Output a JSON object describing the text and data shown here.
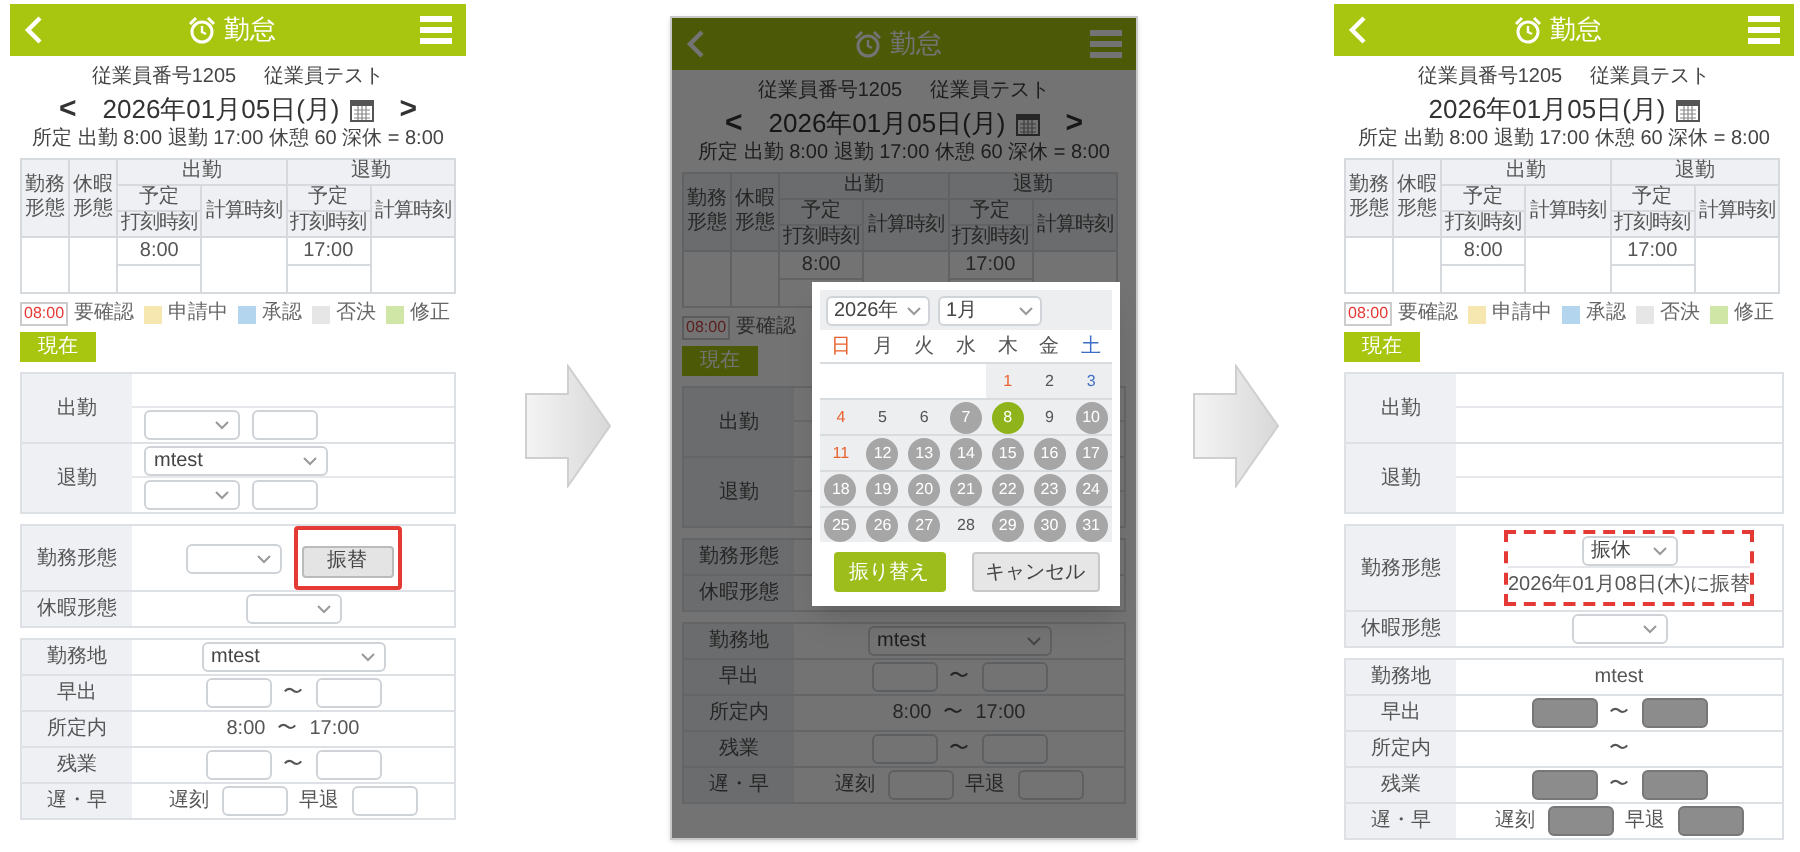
{
  "screens": [
    {
      "header": {
        "title": "勤怠"
      },
      "employee_no": "従業員番号1205",
      "employee_name": "従業員テスト",
      "date": "2026年01月05日(月)",
      "prev_day": "<",
      "next_day": ">",
      "schedule": "所定 出勤 8:00 退勤 17:00 休憩 60 深休 = 8:00",
      "table": {
        "work_type": "勤務形態",
        "leave_type": "休暇形態",
        "groups": [
          {
            "title": "出勤",
            "planned": "予定",
            "stamped": "打刻時刻",
            "calculated": "計算時刻",
            "planned_time": "8:00"
          },
          {
            "title": "退勤",
            "planned": "予定",
            "stamped": "打刻時刻",
            "calculated": "計算時刻",
            "planned_time": "17:00"
          }
        ]
      },
      "legend": [
        {
          "kind": "sample",
          "sample": "08:00",
          "label": "要確認",
          "color": "#e53935"
        },
        {
          "kind": "swatch",
          "label": "申請中",
          "color": "#f6e7b0"
        },
        {
          "kind": "swatch",
          "label": "承認",
          "color": "#b3d6ee"
        },
        {
          "kind": "swatch",
          "label": "否決",
          "color": "#e6e6e6"
        },
        {
          "kind": "swatch",
          "label": "修正",
          "color": "#cfe6a6"
        }
      ],
      "now_button": "現在",
      "sections": [
        {
          "kind": "punch",
          "rows": [
            {
              "label": "出勤",
              "lines": [
                {
                  "kind": "blank"
                },
                {
                  "kind": "fields",
                  "items": [
                    {
                      "kind": "select"
                    },
                    {
                      "kind": "input",
                      "disabled": false
                    }
                  ]
                }
              ]
            },
            {
              "label": "退勤",
              "lines": [
                {
                  "kind": "fields",
                  "items": [
                    {
                      "kind": "select",
                      "value": "mtest",
                      "wide": true
                    }
                  ]
                },
                {
                  "kind": "fields",
                  "items": [
                    {
                      "kind": "select"
                    },
                    {
                      "kind": "input",
                      "disabled": false
                    }
                  ]
                }
              ]
            }
          ]
        },
        {
          "kind": "detail",
          "rows": [
            {
              "label": "勤務形態",
              "lines": [
                {
                  "kind": "fields",
                  "items": [
                    {
                      "kind": "select"
                    },
                    {
                      "kind": "button",
                      "label": "振替",
                      "outlined": true
                    }
                  ]
                }
              ]
            },
            {
              "label": "休暇形態",
              "lines": [
                {
                  "kind": "fields",
                  "items": [
                    {
                      "kind": "select"
                    }
                  ]
                }
              ]
            }
          ]
        },
        {
          "kind": "detail",
          "rows": [
            {
              "label": "勤務地",
              "lines": [
                {
                  "kind": "fields",
                  "items": [
                    {
                      "kind": "select",
                      "value": "mtest",
                      "wide": true
                    }
                  ]
                }
              ]
            },
            {
              "label": "早出",
              "lines": [
                {
                  "kind": "fields",
                  "items": [
                    {
                      "kind": "input",
                      "disabled": false
                    },
                    {
                      "kind": "text",
                      "text": "〜"
                    },
                    {
                      "kind": "input",
                      "disabled": false
                    }
                  ]
                }
              ]
            },
            {
              "label": "所定内",
              "lines": [
                {
                  "kind": "fields",
                  "items": [
                    {
                      "kind": "text",
                      "text": "8:00"
                    },
                    {
                      "kind": "text",
                      "text": "〜"
                    },
                    {
                      "kind": "text",
                      "text": "17:00"
                    }
                  ]
                }
              ]
            },
            {
              "label": "残業",
              "lines": [
                {
                  "kind": "fields",
                  "items": [
                    {
                      "kind": "input",
                      "disabled": false
                    },
                    {
                      "kind": "text",
                      "text": "〜"
                    },
                    {
                      "kind": "input",
                      "disabled": false
                    }
                  ]
                }
              ]
            },
            {
              "label": "遅・早",
              "lines": [
                {
                  "kind": "fields",
                  "items": [
                    {
                      "kind": "text",
                      "text": "遅刻"
                    },
                    {
                      "kind": "input",
                      "disabled": false
                    },
                    {
                      "kind": "text",
                      "text": "早退"
                    },
                    {
                      "kind": "input",
                      "disabled": false
                    }
                  ]
                }
              ]
            }
          ]
        }
      ]
    },
    {
      "header": {
        "title": "勤怠"
      },
      "employee_no": "従業員番号1205",
      "employee_name": "従業員テスト",
      "date": "2026年01月05日(月)",
      "prev_day": "<",
      "next_day": ">",
      "schedule": "所定 出勤 8:00 退勤 17:00 休憩 60 深休 = 8:00",
      "table": {
        "work_type": "勤務形態",
        "leave_type": "休暇形態",
        "groups": [
          {
            "title": "出勤",
            "planned": "予定",
            "stamped": "打刻時刻",
            "calculated": "計算時刻",
            "planned_time": "8:00"
          },
          {
            "title": "退勤",
            "planned": "予定",
            "stamped": "打刻時刻",
            "calculated": "計算時刻",
            "planned_time": "17:00"
          }
        ]
      },
      "legend": [
        {
          "kind": "sample",
          "sample": "08:00",
          "label": "要確認"
        }
      ],
      "now_button": "現在",
      "sections": [
        {
          "kind": "punch",
          "rows": [
            {
              "label": "出勤",
              "lines": [
                {
                  "kind": "blank"
                },
                {
                  "kind": "blank"
                }
              ]
            },
            {
              "label": "退勤",
              "lines": [
                {
                  "kind": "blank"
                },
                {
                  "kind": "blank"
                }
              ]
            }
          ]
        },
        {
          "kind": "detail",
          "rows": [
            {
              "label": "勤務形態",
              "lines": [
                {
                  "kind": "blank"
                }
              ]
            },
            {
              "label": "休暇形態",
              "lines": [
                {
                  "kind": "blank"
                }
              ]
            }
          ]
        },
        {
          "kind": "detail",
          "rows": [
            {
              "label": "勤務地",
              "lines": [
                {
                  "kind": "fields",
                  "items": [
                    {
                      "kind": "select",
                      "value": "mtest",
                      "wide": true
                    }
                  ]
                }
              ]
            },
            {
              "label": "早出",
              "lines": [
                {
                  "kind": "fields",
                  "items": [
                    {
                      "kind": "input",
                      "disabled": false
                    },
                    {
                      "kind": "text",
                      "text": "〜"
                    },
                    {
                      "kind": "input",
                      "disabled": false
                    }
                  ]
                }
              ]
            },
            {
              "label": "所定内",
              "lines": [
                {
                  "kind": "fields",
                  "items": [
                    {
                      "kind": "text",
                      "text": "8:00"
                    },
                    {
                      "kind": "text",
                      "text": "〜"
                    },
                    {
                      "kind": "text",
                      "text": "17:00"
                    }
                  ]
                }
              ]
            },
            {
              "label": "残業",
              "lines": [
                {
                  "kind": "fields",
                  "items": [
                    {
                      "kind": "input",
                      "disabled": false
                    },
                    {
                      "kind": "text",
                      "text": "〜"
                    },
                    {
                      "kind": "input",
                      "disabled": false
                    }
                  ]
                }
              ]
            },
            {
              "label": "遅・早",
              "lines": [
                {
                  "kind": "fields",
                  "items": [
                    {
                      "kind": "text",
                      "text": "遅刻"
                    },
                    {
                      "kind": "input",
                      "disabled": false
                    },
                    {
                      "kind": "text",
                      "text": "早退"
                    },
                    {
                      "kind": "input",
                      "disabled": false
                    }
                  ]
                }
              ]
            }
          ]
        }
      ],
      "dialog": {
        "year": "2026年",
        "month": "1月",
        "weekdays": [
          {
            "label": "日",
            "kind": "sunday"
          },
          {
            "label": "月",
            "kind": "weekday"
          },
          {
            "label": "火",
            "kind": "weekday"
          },
          {
            "label": "水",
            "kind": "weekday"
          },
          {
            "label": "木",
            "kind": "weekday"
          },
          {
            "label": "金",
            "kind": "weekday"
          },
          {
            "label": "土",
            "kind": "saturday"
          }
        ],
        "weeks": [
          [
            {
              "kind": "blank"
            },
            {
              "kind": "blank"
            },
            {
              "kind": "blank"
            },
            {
              "kind": "blank"
            },
            {
              "day": "1",
              "kind": "holiday",
              "disabled": false,
              "selected": false
            },
            {
              "day": "2",
              "kind": "weekday",
              "disabled": false,
              "selected": false
            },
            {
              "day": "3",
              "kind": "saturday",
              "disabled": false,
              "selected": false
            }
          ],
          [
            {
              "day": "4",
              "kind": "sunday",
              "disabled": false,
              "selected": false
            },
            {
              "day": "5",
              "kind": "weekday",
              "disabled": false,
              "selected": false
            },
            {
              "day": "6",
              "kind": "weekday",
              "disabled": false,
              "selected": false
            },
            {
              "day": "7",
              "disabled": true,
              "selected": false
            },
            {
              "day": "8",
              "disabled": false,
              "selected": true
            },
            {
              "day": "9",
              "kind": "weekday",
              "disabled": false,
              "selected": false
            },
            {
              "day": "10",
              "disabled": true,
              "selected": false
            }
          ],
          [
            {
              "day": "11",
              "kind": "sunday",
              "disabled": false,
              "selected": false
            },
            {
              "day": "12",
              "disabled": true,
              "selected": false
            },
            {
              "day": "13",
              "disabled": true,
              "selected": false
            },
            {
              "day": "14",
              "disabled": true,
              "selected": false
            },
            {
              "day": "15",
              "disabled": true,
              "selected": false
            },
            {
              "day": "16",
              "disabled": true,
              "selected": false
            },
            {
              "day": "17",
              "disabled": true,
              "selected": false
            }
          ],
          [
            {
              "day": "18",
              "disabled": true,
              "selected": false
            },
            {
              "day": "19",
              "disabled": true,
              "selected": false
            },
            {
              "day": "20",
              "disabled": true,
              "selected": false
            },
            {
              "day": "21",
              "disabled": true,
              "selected": false
            },
            {
              "day": "22",
              "disabled": true,
              "selected": false
            },
            {
              "day": "23",
              "disabled": true,
              "selected": false
            },
            {
              "day": "24",
              "disabled": true,
              "selected": false
            }
          ],
          [
            {
              "day": "25",
              "disabled": true,
              "selected": false
            },
            {
              "day": "26",
              "disabled": true,
              "selected": false
            },
            {
              "day": "27",
              "disabled": true,
              "selected": false
            },
            {
              "day": "28",
              "kind": "weekday",
              "disabled": false,
              "selected": false
            },
            {
              "day": "29",
              "disabled": true,
              "selected": false
            },
            {
              "day": "30",
              "disabled": true,
              "selected": false
            },
            {
              "day": "31",
              "disabled": true,
              "selected": false
            }
          ]
        ],
        "confirm": "振り替え",
        "cancel": "キャンセル"
      }
    },
    {
      "header": {
        "title": "勤怠"
      },
      "employee_no": "従業員番号1205",
      "employee_name": "従業員テスト",
      "date": "2026年01月05日(月)",
      "schedule": "所定 出勤 8:00 退勤 17:00 休憩 60 深休 = 8:00",
      "table": {
        "work_type": "勤務形態",
        "leave_type": "休暇形態",
        "groups": [
          {
            "title": "出勤",
            "planned": "予定",
            "stamped": "打刻時刻",
            "calculated": "計算時刻",
            "planned_time": "8:00"
          },
          {
            "title": "退勤",
            "planned": "予定",
            "stamped": "打刻時刻",
            "calculated": "計算時刻",
            "planned_time": "17:00"
          }
        ]
      },
      "legend": [
        {
          "kind": "sample",
          "sample": "08:00",
          "label": "要確認",
          "color": "#e53935"
        },
        {
          "kind": "swatch",
          "label": "申請中",
          "color": "#f6e7b0"
        },
        {
          "kind": "swatch",
          "label": "承認",
          "color": "#b3d6ee"
        },
        {
          "kind": "swatch",
          "label": "否決",
          "color": "#e6e6e6"
        },
        {
          "kind": "swatch",
          "label": "修正",
          "color": "#cfe6a6"
        }
      ],
      "now_button": "現在",
      "sections": [
        {
          "kind": "punch",
          "rows": [
            {
              "label": "出勤",
              "lines": [
                {
                  "kind": "blank"
                },
                {
                  "kind": "blank"
                }
              ]
            },
            {
              "label": "退勤",
              "lines": [
                {
                  "kind": "blank"
                },
                {
                  "kind": "blank"
                }
              ]
            }
          ]
        },
        {
          "kind": "detail",
          "rows": [
            {
              "label": "勤務形態",
              "callout": true,
              "lines": [
                {
                  "kind": "fields",
                  "items": [
                    {
                      "kind": "select",
                      "value": "振休"
                    }
                  ]
                },
                {
                  "kind": "fields",
                  "items": [
                    {
                      "kind": "text",
                      "text": "2026年01月08日(木)に振替"
                    }
                  ]
                }
              ]
            },
            {
              "label": "休暇形態",
              "lines": [
                {
                  "kind": "fields",
                  "items": [
                    {
                      "kind": "select"
                    }
                  ]
                }
              ]
            }
          ]
        },
        {
          "kind": "detail",
          "rows": [
            {
              "label": "勤務地",
              "lines": [
                {
                  "kind": "fields",
                  "items": [
                    {
                      "kind": "text",
                      "text": "mtest"
                    }
                  ]
                }
              ]
            },
            {
              "label": "早出",
              "lines": [
                {
                  "kind": "fields",
                  "items": [
                    {
                      "kind": "input",
                      "disabled": true
                    },
                    {
                      "kind": "text",
                      "text": "〜"
                    },
                    {
                      "kind": "input",
                      "disabled": true
                    }
                  ]
                }
              ]
            },
            {
              "label": "所定内",
              "lines": [
                {
                  "kind": "fields",
                  "items": [
                    {
                      "kind": "text",
                      "text": "〜"
                    }
                  ]
                }
              ]
            },
            {
              "label": "残業",
              "lines": [
                {
                  "kind": "fields",
                  "items": [
                    {
                      "kind": "input",
                      "disabled": true
                    },
                    {
                      "kind": "text",
                      "text": "〜"
                    },
                    {
                      "kind": "input",
                      "disabled": true
                    }
                  ]
                }
              ]
            },
            {
              "label": "遅・早",
              "lines": [
                {
                  "kind": "fields",
                  "items": [
                    {
                      "kind": "text",
                      "text": "遅刻"
                    },
                    {
                      "kind": "input",
                      "disabled": true
                    },
                    {
                      "kind": "text",
                      "text": "早退"
                    },
                    {
                      "kind": "input",
                      "disabled": true
                    }
                  ]
                }
              ]
            }
          ]
        }
      ]
    }
  ]
}
